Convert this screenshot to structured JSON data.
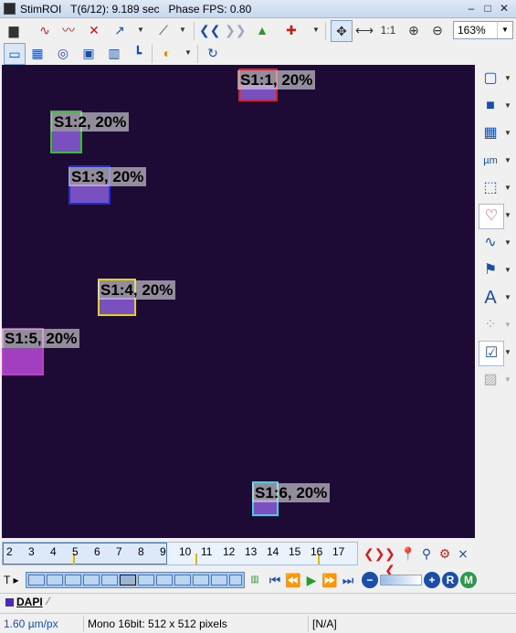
{
  "window": {
    "title": "StimROI",
    "time_info": "T(6/12): 9.189 sec",
    "fps_info": "Phase FPS: 0.80"
  },
  "toolbar": {
    "zoom_reset_label": "1:1",
    "zoom_value": "163%"
  },
  "rois": [
    {
      "label": "S1:1, 20%",
      "color": "#e02020"
    },
    {
      "label": "S1:2, 20%",
      "color": "#30c030"
    },
    {
      "label": "S1:3, 20%",
      "color": "#2030d0"
    },
    {
      "label": "S1:4, 20%",
      "color": "#e0d020"
    },
    {
      "label": "S1:5, 20%",
      "color": "#c040c0"
    },
    {
      "label": "S1:6, 20%",
      "color": "#40d0e0"
    }
  ],
  "right_tools": [
    "rectangle-roi-icon",
    "filled-rectangle-icon",
    "grid-icon",
    "measure-um-icon",
    "crop-icon",
    "heart-tag-icon",
    "waveform-icon",
    "flag-icon",
    "text-icon",
    "dots-icon",
    "checklist-icon",
    "disabled-pattern-icon"
  ],
  "timeline": {
    "ticks": [
      "2",
      "3",
      "4",
      "5",
      "6",
      "7",
      "8",
      "9",
      "10",
      "11",
      "12",
      "13",
      "14",
      "15",
      "16",
      "17"
    ],
    "t_label": "T"
  },
  "channel_tab": {
    "label": "DAPI",
    "color": "#4b2bb5"
  },
  "status": {
    "scale": "1.60 µm/px",
    "format": "Mono 16bit: 512 x 512 pixels",
    "value": "[N/A]"
  }
}
